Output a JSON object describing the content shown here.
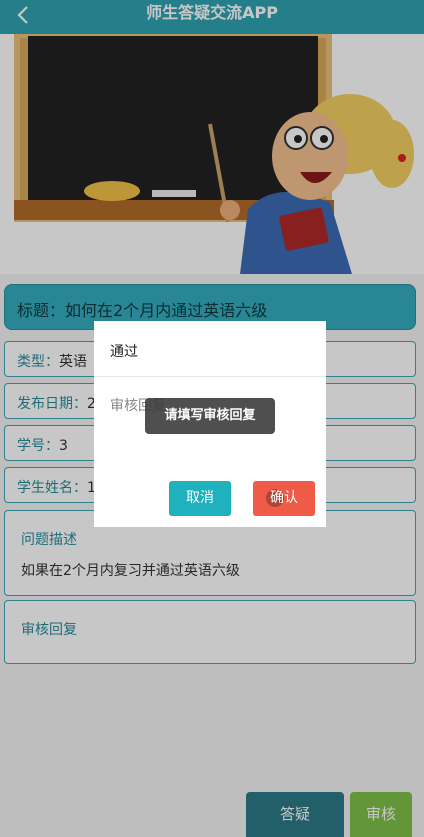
{
  "header": {
    "title": "师生答疑交流APP",
    "back_icon": "chevron-left-icon"
  },
  "banner": {
    "image": "teacher-at-chalkboard-illustration"
  },
  "detail": {
    "title_prefix": "标题：",
    "title_value": "如何在2个月内通过英语六级",
    "type_label": "类型：",
    "type_value": "英语",
    "date_label": "发布日期：",
    "date_value": "2",
    "student_id_label": "学号：",
    "student_id_value": "3",
    "student_name_label": "学生姓名：",
    "student_name_value": "1",
    "description_label": "问题描述",
    "description_text": "如果在2个月内复习并通过英语六级",
    "reply_label": "审核回复"
  },
  "bottom_bar": {
    "answer_label": "答疑",
    "review_label": "审核"
  },
  "dialog": {
    "status": "通过",
    "reply_placeholder": "审核回复",
    "cancel_label": "取消",
    "confirm_label": "确认"
  },
  "toast": {
    "message": "请填写审核回复"
  },
  "colors": {
    "primary": "#2fa3b3",
    "cancel": "#1fb1bd",
    "confirm": "#ef5b46",
    "answer_button": "#2d7a86",
    "review_button": "#7ec04a"
  }
}
